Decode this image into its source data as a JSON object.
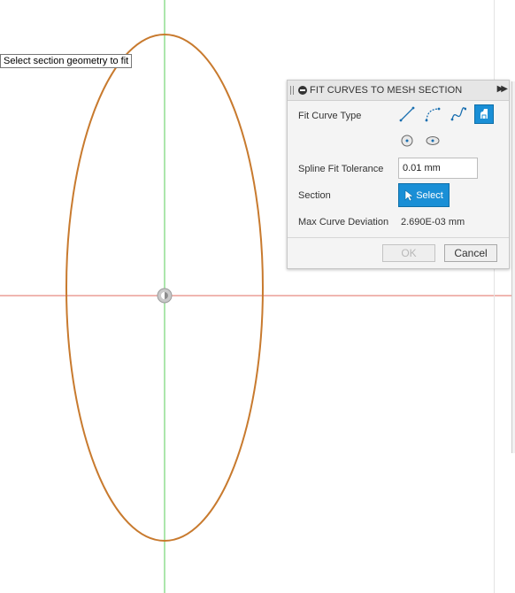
{
  "tooltip": {
    "text": "Select section geometry to fit"
  },
  "dialog": {
    "title": "FIT CURVES TO MESH SECTION",
    "fit_curve_type_label": "Fit Curve Type",
    "curve_type_icons": [
      "line-icon",
      "arc-icon",
      "spline-icon",
      "auto-fit-icon",
      "circle-icon",
      "ellipse-icon"
    ],
    "active_curve_type": "auto-fit-icon",
    "spline_tolerance_label": "Spline Fit Tolerance",
    "spline_tolerance_value": "0.01 mm",
    "section_label": "Section",
    "select_label": "Select",
    "max_deviation_label": "Max Curve Deviation",
    "max_deviation_value": "2.690E-03 mm",
    "ok_label": "OK",
    "cancel_label": "Cancel"
  },
  "colors": {
    "accent": "#1a8fd6",
    "section_curve": "#c87a2e",
    "x_axis": "#e06d62",
    "y_axis": "#74d674"
  }
}
